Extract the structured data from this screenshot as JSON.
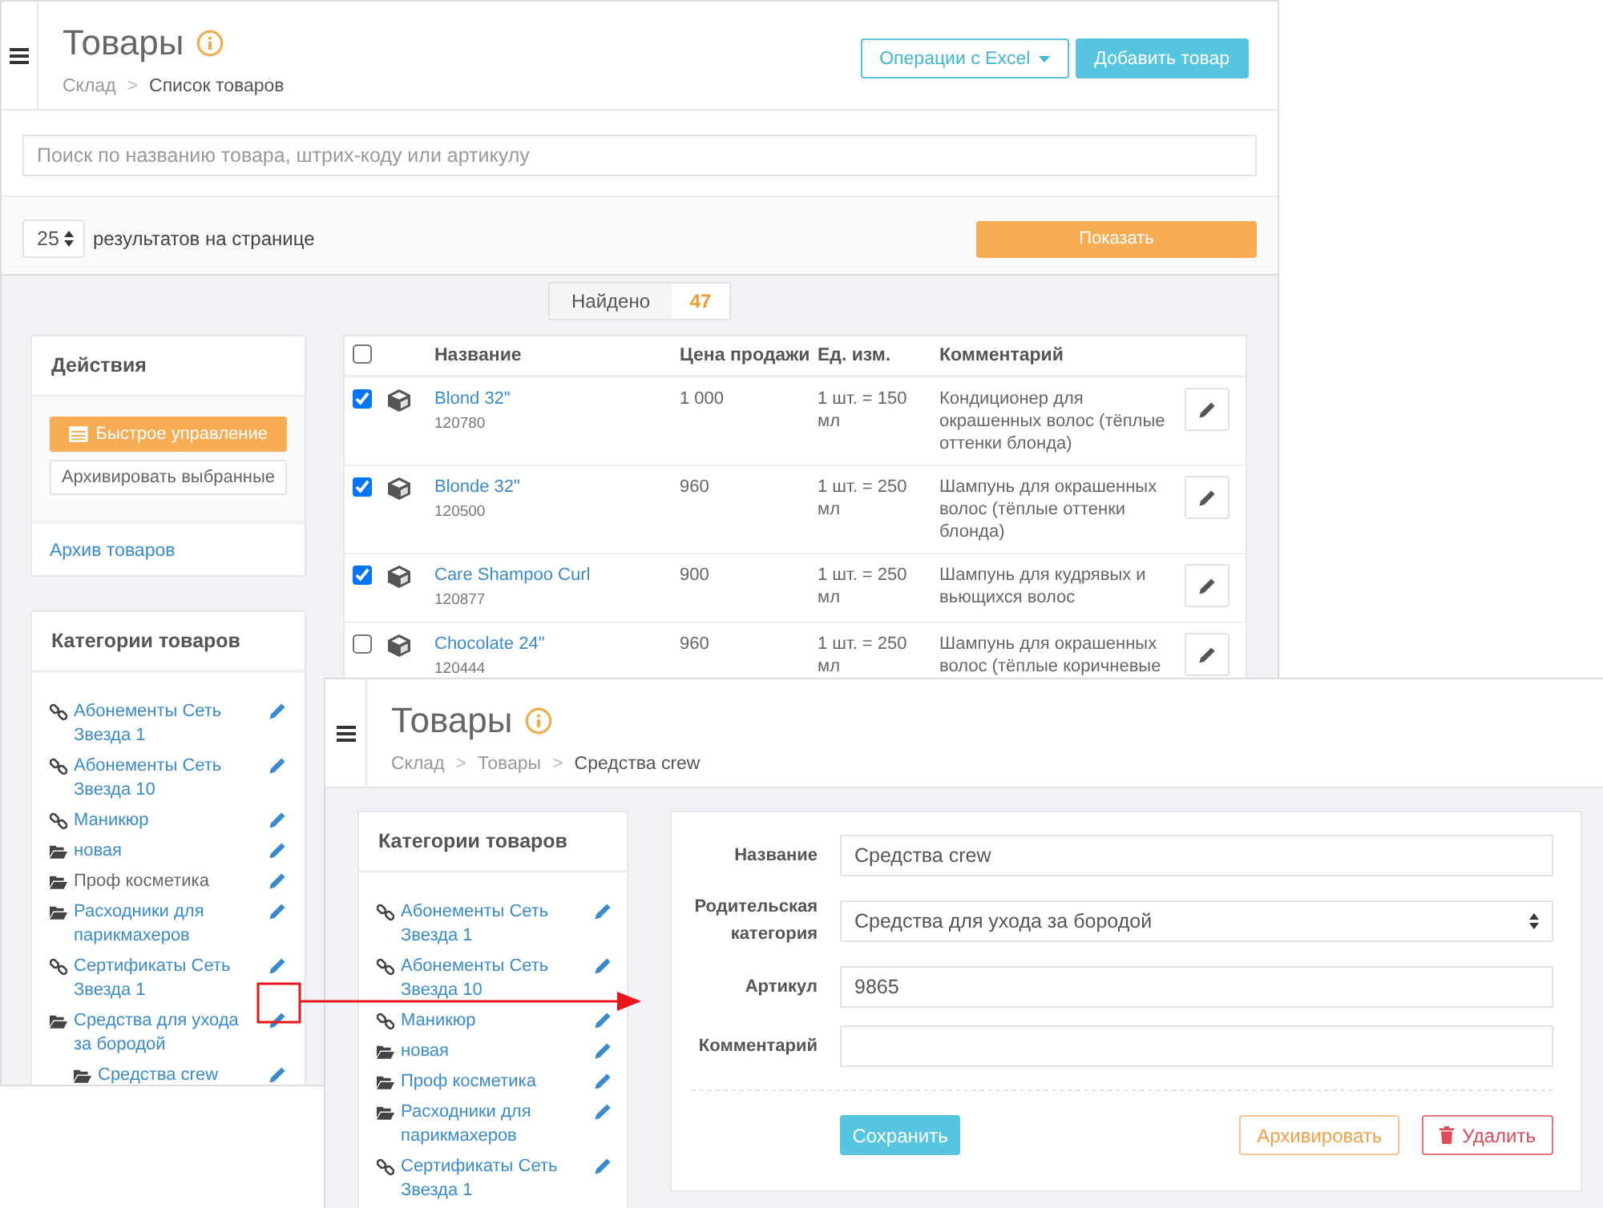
{
  "list_window": {
    "title": "Товары",
    "breadcrumb": [
      "Склад",
      ">",
      "Список товаров"
    ],
    "header_buttons": [
      {
        "label": "Операции с Excel",
        "kind": "dropdown"
      },
      {
        "label": "Добавить товар",
        "kind": "primary"
      }
    ],
    "search": {
      "placeholder": "Поиск по названию товара, штрих-коду или артикулу"
    },
    "per_page": {
      "value": "25",
      "label": "результатов на странице"
    },
    "show_button": "Показать",
    "found": {
      "label": "Найдено",
      "count": "47"
    },
    "actions": {
      "title": "Действия",
      "buttons": [
        {
          "label": "Быстрое управление",
          "kind": "primary"
        },
        {
          "label": "Архивировать выбранные",
          "kind": "default"
        }
      ],
      "link": "Архив товаров"
    },
    "categories": {
      "title": "Категории товаров",
      "items": [
        {
          "label": "Абонементы Сеть Звезда 1",
          "kind": "link",
          "active": false
        },
        {
          "label": "Абонементы Сеть Звезда 10",
          "kind": "link",
          "active": false
        },
        {
          "label": "Маникюр",
          "kind": "link",
          "active": false
        },
        {
          "label": "новая",
          "kind": "folder",
          "active": false
        },
        {
          "label": "Проф косметика",
          "kind": "folder",
          "active": true
        },
        {
          "label": "Расходники для парикмахеров",
          "kind": "folder",
          "active": false
        },
        {
          "label": "Сертификаты Сеть Звезда 1",
          "kind": "link",
          "active": false
        },
        {
          "label": "Средства для ухода за бородой",
          "kind": "folder",
          "active": false,
          "children": [
            {
              "label": "Средства crew",
              "kind": "folder",
              "active": false
            }
          ]
        }
      ]
    },
    "table": {
      "all_checked": false,
      "columns": [
        "Название",
        "Цена продажи",
        "Ед. изм.",
        "Комментарий"
      ],
      "rows": [
        {
          "checked": true,
          "name": "Blond 32\"",
          "code": "120780",
          "price": "1 000",
          "unit": "1 шт. = 150 мл",
          "comment": "Кондиционер для окрашенных волос (тёплые оттенки блонда)"
        },
        {
          "checked": true,
          "name": "Blonde 32\"",
          "code": "120500",
          "price": "960",
          "unit": "1 шт. = 250 мл",
          "comment": "Шампунь для окрашенных волос (тёплые оттенки блонда)"
        },
        {
          "checked": true,
          "name": "Care Shampoo Curl",
          "code": "120877",
          "price": "900",
          "unit": "1 шт. = 250 мл",
          "comment": "Шампунь для кудрявых и вьющихся волос"
        },
        {
          "checked": false,
          "name": "Chocolate 24\"",
          "code": "120444",
          "price": "960",
          "unit": "1 шт. = 250 мл",
          "comment": "Шампунь для окрашенных волос (тёплые коричневые"
        }
      ]
    }
  },
  "edit_window": {
    "title": "Товары",
    "breadcrumb": [
      "Склад",
      ">",
      "Товары",
      ">",
      "Средства crew"
    ],
    "categories": {
      "title": "Категории товаров",
      "items": [
        {
          "label": "Абонементы Сеть Звезда 1",
          "kind": "link",
          "active": false
        },
        {
          "label": "Абонементы Сеть Звезда 10",
          "kind": "link",
          "active": false
        },
        {
          "label": "Маникюр",
          "kind": "link",
          "active": false
        },
        {
          "label": "новая",
          "kind": "folder",
          "active": false
        },
        {
          "label": "Проф косметика",
          "kind": "folder",
          "active": false
        },
        {
          "label": "Расходники для парикмахеров",
          "kind": "folder",
          "active": false
        },
        {
          "label": "Сертификаты Сеть Звезда 1",
          "kind": "link",
          "active": false
        }
      ]
    },
    "form": {
      "fields": [
        {
          "label": "Название",
          "value": "Средства crew",
          "kind": "text"
        },
        {
          "label": "Родительская категория",
          "value": "Средства для ухода за бородой",
          "kind": "select"
        },
        {
          "label": "Артикул",
          "value": "9865",
          "kind": "text"
        },
        {
          "label": "Комментарий",
          "kind": "text"
        }
      ],
      "buttons": [
        {
          "label": "Сохранить",
          "kind": "primary"
        },
        {
          "label": "Архивировать",
          "kind": "warning"
        },
        {
          "label": "Удалить",
          "kind": "danger"
        }
      ]
    }
  }
}
